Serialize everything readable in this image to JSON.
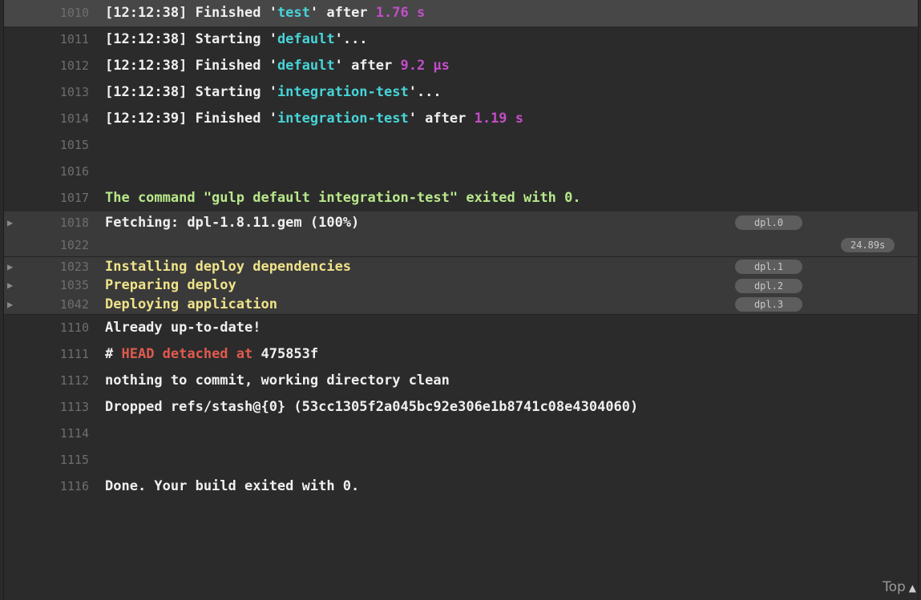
{
  "lines": [
    {
      "num": "1010",
      "parts": [
        {
          "t": "[12:12:38] Finished '",
          "c": "gray"
        },
        {
          "t": "test",
          "c": "cyan"
        },
        {
          "t": "' after ",
          "c": "gray"
        },
        {
          "t": "1.76 s",
          "c": "magenta"
        }
      ]
    },
    {
      "num": "1011",
      "parts": [
        {
          "t": "[12:12:38] Starting '",
          "c": "gray"
        },
        {
          "t": "default",
          "c": "cyan"
        },
        {
          "t": "'...",
          "c": "gray"
        }
      ]
    },
    {
      "num": "1012",
      "parts": [
        {
          "t": "[12:12:38] Finished '",
          "c": "gray"
        },
        {
          "t": "default",
          "c": "cyan"
        },
        {
          "t": "' after ",
          "c": "gray"
        },
        {
          "t": "9.2 μs",
          "c": "magenta"
        }
      ]
    },
    {
      "num": "1013",
      "parts": [
        {
          "t": "[12:12:38] Starting '",
          "c": "gray"
        },
        {
          "t": "integration-test",
          "c": "cyan"
        },
        {
          "t": "'...",
          "c": "gray"
        }
      ]
    },
    {
      "num": "1014",
      "parts": [
        {
          "t": "[12:12:39] Finished '",
          "c": "gray"
        },
        {
          "t": "integration-test",
          "c": "cyan"
        },
        {
          "t": "' after ",
          "c": "gray"
        },
        {
          "t": "1.19 s",
          "c": "magenta"
        }
      ]
    },
    {
      "num": "1015",
      "parts": []
    },
    {
      "num": "1016",
      "parts": []
    },
    {
      "num": "1017",
      "parts": [
        {
          "t": "The command \"gulp default integration-test\" exited with 0.",
          "c": "green"
        }
      ]
    },
    {
      "num": "1018",
      "fold": true,
      "arrow": "▶",
      "tag": "dpl.0",
      "parts": [
        {
          "t": "Fetching: dpl-1.8.11.gem (100%)",
          "c": "gray"
        }
      ]
    },
    {
      "num": "1022",
      "foldEnd": true,
      "time": "24.89s",
      "parts": []
    },
    {
      "num": "1023",
      "fold": true,
      "arrow": "▶",
      "tag": "dpl.1",
      "parts": [
        {
          "t": "Installing deploy dependencies",
          "c": "yellow"
        }
      ]
    },
    {
      "num": "1035",
      "fold": true,
      "arrow": "▶",
      "tag": "dpl.2",
      "parts": [
        {
          "t": "Preparing deploy",
          "c": "yellow"
        }
      ]
    },
    {
      "num": "1042",
      "fold": true,
      "arrow": "▶",
      "tag": "dpl.3",
      "parts": [
        {
          "t": "Deploying application",
          "c": "yellow"
        }
      ]
    },
    {
      "num": "1110",
      "parts": [
        {
          "t": "Already up-to-date!",
          "c": "gray"
        }
      ]
    },
    {
      "num": "1111",
      "parts": [
        {
          "t": "# ",
          "c": "gray"
        },
        {
          "t": "HEAD detached at ",
          "c": "red"
        },
        {
          "t": "475853f",
          "c": "gray"
        }
      ]
    },
    {
      "num": "1112",
      "parts": [
        {
          "t": "nothing to commit, working directory clean",
          "c": "gray"
        }
      ]
    },
    {
      "num": "1113",
      "parts": [
        {
          "t": "Dropped refs/stash@{0} (53cc1305f2a045bc92e306e1b8741c08e4304060)",
          "c": "gray"
        }
      ]
    },
    {
      "num": "1114",
      "parts": []
    },
    {
      "num": "1115",
      "parts": []
    },
    {
      "num": "1116",
      "parts": [
        {
          "t": "Done. Your build exited with 0.",
          "c": "gray"
        }
      ]
    }
  ],
  "footer": {
    "top_label": "Top",
    "top_arrow": "▲"
  }
}
